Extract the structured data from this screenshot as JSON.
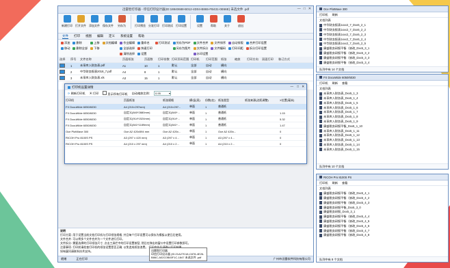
{
  "window": {
    "title": "迅雷智打印器 - 印信打印设计器(ID:18840688-B012-4D04-B865-FB431-0E66E) 未选文件 .pdf"
  },
  "toolbar": {
    "buttons": [
      {
        "label": "新建打印",
        "icon": "new-icon",
        "color": "#2f8bd6"
      },
      {
        "label": "打开文件",
        "icon": "open-icon",
        "color": "#e0a32e"
      },
      {
        "label": "添加文件",
        "icon": "add-file-icon",
        "color": "#2f8bd6"
      },
      {
        "label": "保存文件",
        "icon": "save-icon",
        "color": "#2f8bd6"
      },
      {
        "label": "另存为",
        "icon": "save-as-icon",
        "color": "#d65a3a"
      },
      {
        "label": "打印预览",
        "icon": "preview-icon",
        "color": "#2f8bd6"
      },
      {
        "label": "分发打印",
        "icon": "distribute-icon",
        "color": "#2f8bd6"
      },
      {
        "label": "打印测试",
        "icon": "test-print-icon",
        "color": "#2f8bd6"
      },
      {
        "label": "打印设置",
        "icon": "print-settings-icon",
        "color": "#2f8bd6"
      },
      {
        "label": "设置",
        "icon": "gear-icon",
        "color": "#2f8bd6"
      },
      {
        "label": "帮助",
        "icon": "help-icon",
        "color": "#e0503a"
      },
      {
        "label": "关于",
        "icon": "about-icon",
        "color": "#2f8bd6"
      },
      {
        "label": "退出",
        "icon": "exit-icon",
        "color": "#e0503a"
      }
    ]
  },
  "tabs": [
    "文件",
    "打印",
    "视图",
    "编辑",
    "定义",
    "系统设置",
    "帮助"
  ],
  "ribbon": {
    "col1": [
      "添加",
      "移动"
    ],
    "col2": [
      "删除",
      "删除全部"
    ],
    "col3": [
      "上移",
      "下移"
    ],
    "col4": [
      "文档编辑"
    ],
    "col5": [
      "作业编辑",
      "全部选择",
      "清除选择"
    ],
    "col6": [
      "重命名",
      "快速打印",
      "设置"
    ],
    "col7": [
      "打印测试"
    ],
    "col8": [
      "另存为PDF",
      "另存为图片"
    ],
    "col9": [
      "文件合并",
      "文件拆分",
      "水印设置"
    ],
    "col10": [
      "文件排序",
      "文件编码"
    ],
    "col11": [
      "自动排版",
      "打印间距"
    ],
    "col12": [
      "合并打印设置",
      "拆分打印设置"
    ]
  },
  "grid": {
    "headers": [
      "选择",
      "序号",
      "文件名称",
      "页面纸张",
      "页面数",
      "打印份数",
      "打印页码范围",
      "打印机",
      "打印范围",
      "纸张",
      "缩放",
      "打印方向",
      "双面打印",
      "装订方式"
    ],
    "rows": [
      [
        "1",
        "未享库入财务表.pdf",
        "A1",
        "10",
        "1",
        "默认",
        "全部",
        "自动",
        "横向"
      ],
      [
        "2",
        "中华财务报表2018_7.pdf",
        "A4",
        "8",
        "1",
        "默认",
        "全部",
        "自动",
        "横向"
      ],
      [
        "3",
        "未享库入财务表.xls",
        "A3",
        "15",
        "1",
        "默认",
        "全部",
        "自动",
        "横向"
      ]
    ]
  },
  "dialog": {
    "title": "打印机设置详情",
    "tool": {
      "refresh": "刷新打印机",
      "print": "打印",
      "show_all": "显示所有打印机",
      "scale_label": "自动缩放比例:",
      "scale_value": "0.95"
    },
    "headers": [
      "打印机",
      "页面纸张",
      "纸张规格",
      "横/竖(双)",
      "份数(在)",
      "纸张类型",
      "纸张来源(边距调整)",
      "X位置(毫米)"
    ],
    "rows": [
      [
        "FX DocuWide 6050/6030",
        "A4 (210×297mm)",
        "A4 (210×297...",
        "单面",
        "1",
        "普通纸",
        "",
        ""
      ],
      [
        "FX DocuWide 6050/6030",
        "自定义(840*2880mm)",
        "自定义(840*...",
        "单面",
        "1",
        "普通纸",
        "",
        "1.15"
      ],
      [
        "FX DocuWide 6050/6030",
        "自定义(914*1524mm)",
        "自定义(914*...",
        "单面",
        "1",
        "普通纸",
        "",
        "5.32"
      ],
      [
        "FX DocuWide 6050/6030",
        "自定义(841*1189mm)",
        "自定义(841*...",
        "单面",
        "1",
        "普通纸",
        "",
        "1.47"
      ],
      [
        "Oce PlotWave 300",
        "Oce A2 420x594 mm",
        "Oce A2 420x...",
        "单面",
        "1",
        "Oce A2 420x...",
        "",
        "0"
      ],
      [
        "RICOH Pro 8100S PS",
        "A3 (297 x 420 mm)",
        "A3 (297 x 4...",
        "单面",
        "1",
        "A3 (297 x 4...",
        "",
        "0"
      ],
      [
        "RICOH Pro 8100S PS",
        "A4 (210 x 297 mm)",
        "A4 (210 x 2...",
        "单面",
        "1",
        "A4 (210 x 2...",
        "",
        "0"
      ]
    ]
  },
  "description": {
    "title": "说明",
    "lines": [
      "打印方案: 用于设置当前文档打印机与打印纸张规格, 并且每个打印设置可以保存为模板以便日后使用。",
      "文件合并: 可以将多个文件合并为一个文件进行打印。",
      "文件拆分: 需要选择的打印纸张尺寸, 点击工具栏中的打印设置按钮, 然后在弹出的窗口中设置打印参数即可。",
      "注意事项: 打印前请检查打印机的纸张设置是否正确, 以免造成纸张浪费。 打印完毕后请确认打印结果。",
      "如有疑问请联系技术支持。"
    ]
  },
  "status": {
    "left": "就绪",
    "mid": "正在打印",
    "right": "广州市迅雷软件科技有限公司"
  },
  "tooltip": {
    "lines": [
      "迅雷智打印器",
      "印信打印设计器 (ID:21A27D18-C878-4E26-",
      "B86C-A02C0B45F1C-1847 未选文件 .pdf"
    ]
  },
  "panels": [
    {
      "title": "Oce PlotWave 300",
      "tool": [
        "打印机",
        "刷新"
      ],
      "section": "文档列表",
      "items": [
        "中华财务报表1xxx2_7_Dxx5_2_1",
        "中华财务报表1xxx2_7_Dxx5_2_2",
        "中华财务报表1xxx2_7_Dxx5_2_3",
        "中华财务报表1xxx2_7_Dxx5_2_4",
        "中华财务报表1xxx2_7_Dxx5_2_5",
        "康盛税务研报平衡（修改_Dxx5_3_1",
        "康盛税务研报平衡（修改_Dxx5_3_2",
        "康盛税务研报平衡（修改_Dxx5_3_3",
        "康盛税务研报平衡（修改_Dxx5_3_4"
      ],
      "footer": "队列中有 14 个文档"
    },
    {
      "title": "FX DocuWide 6050/6030",
      "tool": [
        "打印机",
        "刷新",
        "查看"
      ],
      "section": "文档列表",
      "items": [
        "未享库入财务表_Dxx5_1_3",
        "未享库入财务表_Dxx5_1_4",
        "未享库入财务表_Dxx5_1_5",
        "未享库入财务表_Dxx5_1_6",
        "未享库入财务表_Dxx5_1_7",
        "未享库入财务表_Dxx5_1_8",
        "未享库入财务表_Dxx5_1_9",
        "康盛税务研报平衡_Dxx5_1_10",
        "未享库入财务表_Dxx5_1_11",
        "未享库入财务表_Dxx5_1_12",
        "未享库入财务表_Dxx5_1_13",
        "未享库入财务表_Dxx5_1_14",
        "未享库入财务表_Dxx5_1_15"
      ],
      "footer": "队列中有 10 个文档"
    },
    {
      "title": "RICOH Pro 8100S PS",
      "tool": [
        "打印机",
        "刷新",
        "查看"
      ],
      "section": "文档列表",
      "items": [
        "康盛税务研报平衡（修改_Dxx5_4_1",
        "康盛税务研报平衡（修改_Dxx5_4_2",
        "康盛税务研报平衡（修改_Dxx5_4_3",
        "康盛税务研报平衡_Dxx5_3_0",
        "康盛税务研报_Dxx5_3_1",
        "康盛税务研报平衡（修改_Dxx5_4_4",
        "康盛税务研报平衡（修改_Dxx5_4_5",
        "康盛税务研报平衡（修改_Dxx5_4_6",
        "康盛税务研报平衡（修改_Dxx5_4_7",
        "康盛税务研报平衡（修改_Dxx5_4_8"
      ],
      "footer": "队列中有 8 个文档"
    }
  ]
}
